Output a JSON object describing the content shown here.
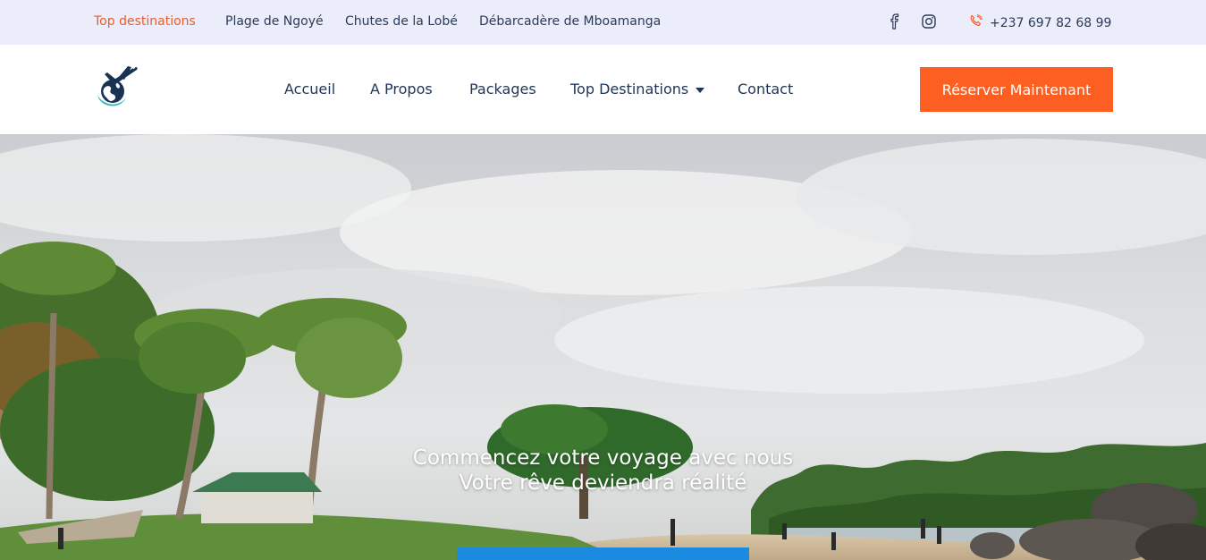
{
  "topbar": {
    "links": [
      {
        "label": "Top destinations",
        "active": true
      },
      {
        "label": "Plage de Ngoyé"
      },
      {
        "label": "Chutes de la Lobé"
      },
      {
        "label": "Débarcadère de Mboamanga"
      }
    ],
    "social_icons": [
      "facebook-icon",
      "instagram-icon"
    ],
    "phone_icon": "phone-icon",
    "phone": "+237 697 82 68 99",
    "active_color": "#f05a28",
    "background": "#ecedfb"
  },
  "header": {
    "logo_icon": "airplane-globe-logo",
    "nav": [
      {
        "label": "Accueil"
      },
      {
        "label": "A Propos"
      },
      {
        "label": "Packages"
      },
      {
        "label": "Top Destinations",
        "dropdown": true
      },
      {
        "label": "Contact"
      }
    ],
    "cta_label": "Réserver Maintenant",
    "cta_color": "#fd5e22"
  },
  "hero": {
    "line1": "Commencez votre voyage avec nous",
    "line2": "Votre rêve deviendra réalité",
    "button_color": "#1a8be0"
  }
}
